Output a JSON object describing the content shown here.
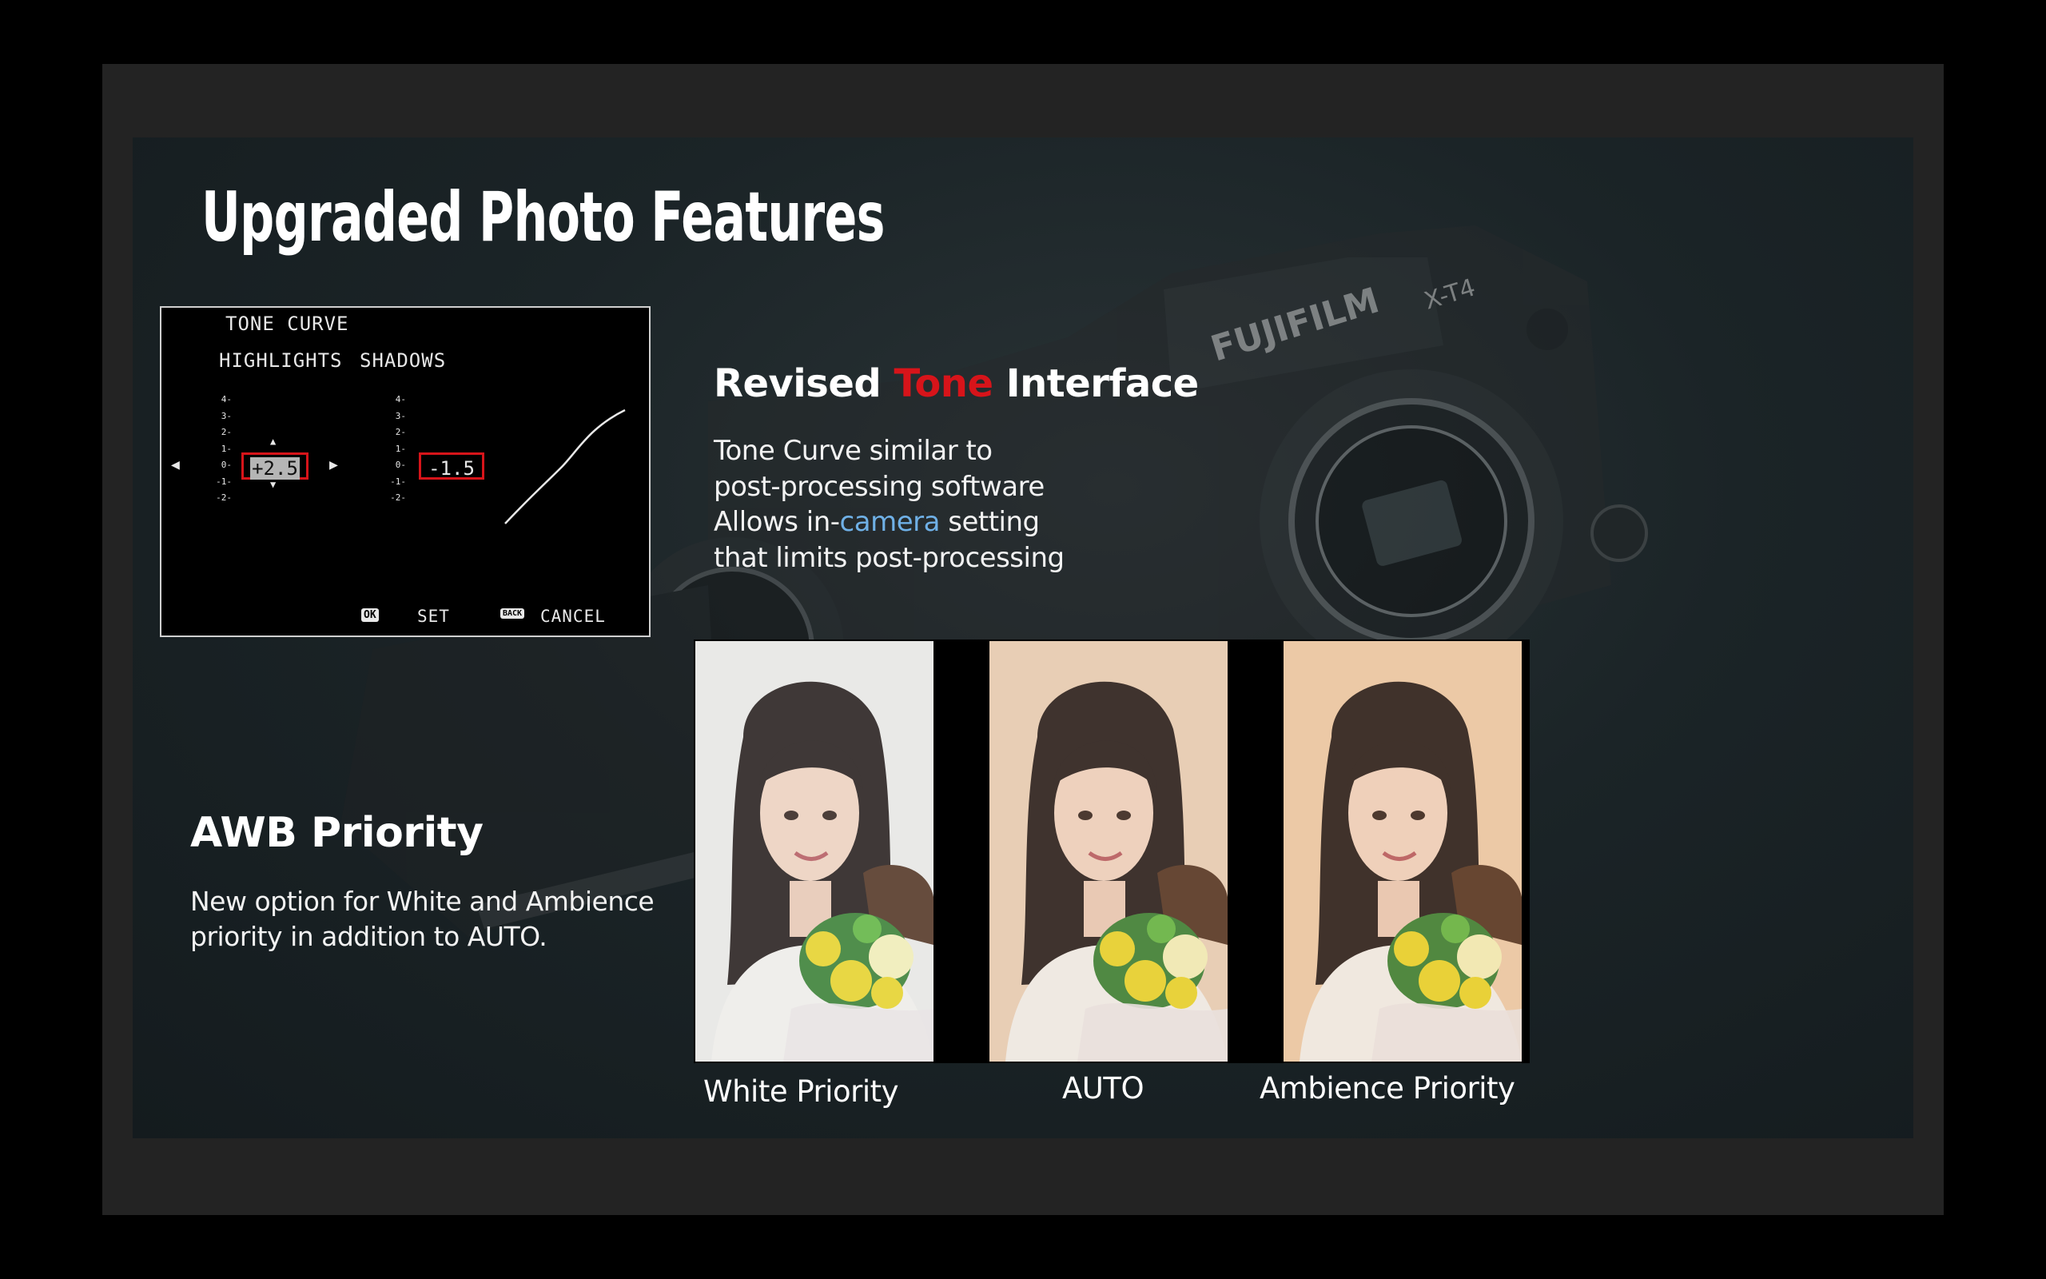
{
  "slide": {
    "title": "Upgraded Photo Features"
  },
  "tone_curve_panel": {
    "title": "TONE CURVE",
    "highlights_label": "HIGHLIGHTS",
    "shadows_label": "SHADOWS",
    "scale": [
      "4-",
      "3-",
      "2-",
      "1-",
      "0-",
      "-1-",
      "-2-"
    ],
    "highlights_value": "+2.5",
    "shadows_value": "-1.5",
    "ok_key": "OK",
    "set_label": "SET",
    "back_key": "BACK",
    "cancel_label": "CANCEL"
  },
  "tone_section": {
    "title_part1": "Revised ",
    "title_highlight": "Tone",
    "title_part2": " Interface",
    "line1": "Tone Curve similar to",
    "line2": "post-processing software",
    "line3_part1": "Allows in-",
    "line3_highlight": "camera",
    "line3_part2": " setting",
    "line4": "that limits post-processing"
  },
  "awb_section": {
    "title": "AWB Priority",
    "line1": "New option for White and Ambience",
    "line2": "priority in addition to AUTO."
  },
  "photo_comparison": [
    {
      "caption": "White Priority",
      "tint": "#e9e9e7"
    },
    {
      "caption": "AUTO",
      "tint": "#e8cfb5"
    },
    {
      "caption": "Ambience Priority",
      "tint": "#eccaa6"
    }
  ],
  "colors": {
    "accent_red": "#d7141a",
    "accent_blue": "#6fb0e6",
    "slide_bg": "#1b2427",
    "frame_bg": "#232323"
  }
}
